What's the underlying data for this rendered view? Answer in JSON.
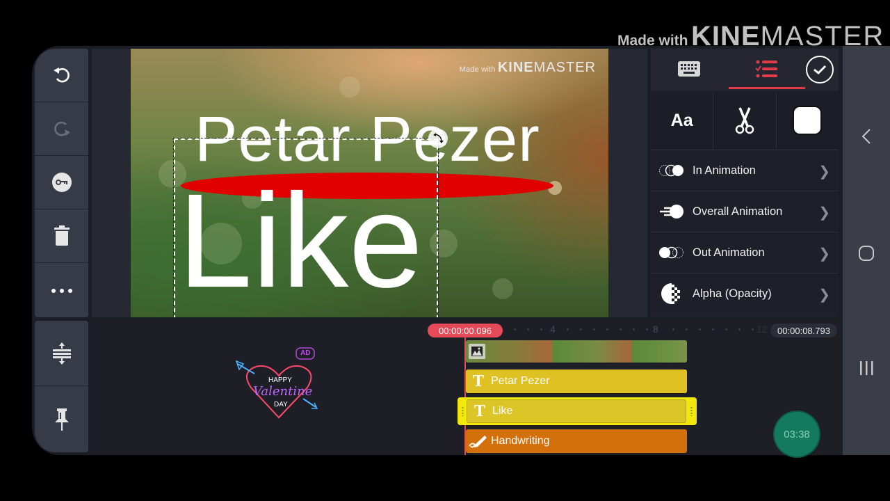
{
  "watermark": {
    "made_with": "Made with",
    "brand_bold": "KINE",
    "brand_light": "MASTER"
  },
  "left_toolbar": {
    "items": [
      {
        "name": "undo",
        "icon": "undo-icon",
        "enabled": true
      },
      {
        "name": "redo",
        "icon": "redo-icon",
        "enabled": false
      },
      {
        "name": "keyframe",
        "icon": "key-icon",
        "enabled": true
      },
      {
        "name": "delete",
        "icon": "trash-icon",
        "enabled": true
      },
      {
        "name": "more",
        "icon": "more-icon",
        "enabled": true
      }
    ],
    "bottom_items": [
      {
        "name": "expand-timeline",
        "icon": "expand-vertical-icon"
      },
      {
        "name": "pin",
        "icon": "pin-icon"
      }
    ]
  },
  "preview": {
    "title_text": "Petar Pezer",
    "selected_text": "Like",
    "highlight_color": "#e00000"
  },
  "right_panel": {
    "tabs": [
      {
        "name": "keyboard",
        "icon": "keyboard-icon",
        "active": false
      },
      {
        "name": "options",
        "icon": "checklist-icon",
        "active": true
      }
    ],
    "confirm_icon": "check-circle-icon",
    "tools": [
      {
        "name": "font",
        "label": "Aa"
      },
      {
        "name": "split",
        "icon": "scissors-icon"
      },
      {
        "name": "color",
        "icon": "color-swatch",
        "value": "#ffffff"
      }
    ],
    "options": [
      {
        "label": "In Animation",
        "icon": "in-animation-icon"
      },
      {
        "label": "Overall Animation",
        "icon": "overall-animation-icon"
      },
      {
        "label": "Out Animation",
        "icon": "out-animation-icon"
      },
      {
        "label": "Alpha (Opacity)",
        "icon": "alpha-opacity-icon"
      }
    ],
    "accent_color": "#e23c4a"
  },
  "timeline": {
    "playhead_time": "00:00:00.096",
    "end_time": "00:00:08.793",
    "ruler_labels": [
      "4",
      "8",
      "12"
    ],
    "layers": [
      {
        "label": "Petar Pezer",
        "type": "text",
        "color": "#dfc123"
      },
      {
        "label": "Like",
        "type": "text",
        "color": "#dcc527",
        "selected": true
      },
      {
        "label": "Handwriting",
        "type": "handwriting",
        "color": "#d4700c"
      }
    ],
    "sticker": {
      "ad_badge": "AD",
      "line1": "HAPPY",
      "line2": "Valentine",
      "line3": "DAY"
    },
    "record_button": "03:38"
  },
  "navbar": {
    "back": "back-icon",
    "home": "home-icon",
    "recents": "recents-icon"
  }
}
